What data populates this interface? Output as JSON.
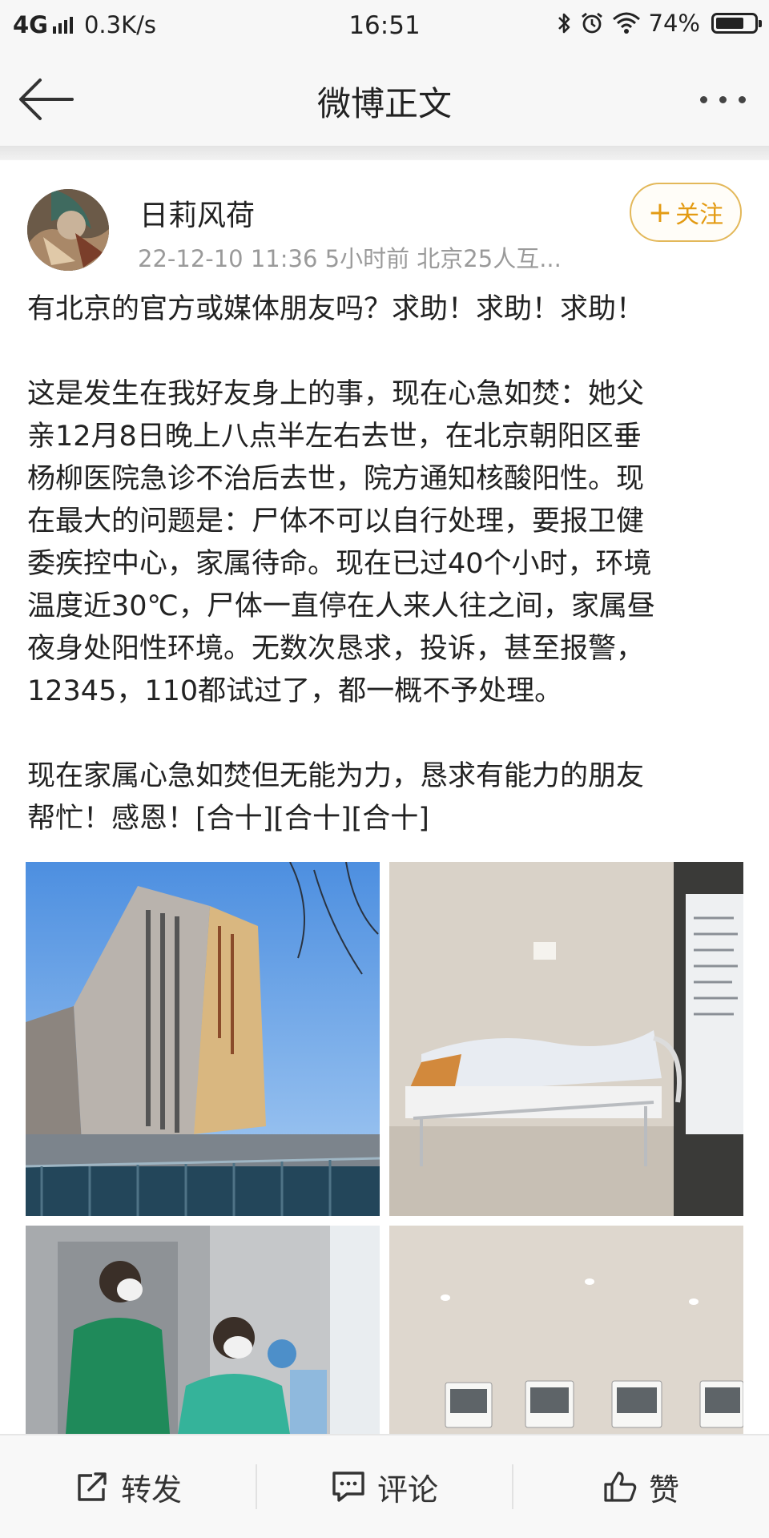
{
  "status_bar": {
    "network": "4G",
    "speed": "0.3K/s",
    "time": "16:51",
    "battery": "74%",
    "battery_level": 0.74
  },
  "nav": {
    "title": "微博正文",
    "back_icon": "arrow-left-icon",
    "more_icon": "more-dots-icon"
  },
  "post": {
    "username": "日莉风荷",
    "meta": "22-12-10 11:36   5小时前 北京25人互...",
    "follow_label": "关注",
    "paragraphs": [
      [
        "有北京的官方或媒体朋友吗？求助！求助！求助！"
      ],
      [
        "这是发生在我好友身上的事，现在心急如焚：她父",
        "亲12月8日晚上八点半左右去世，在北京朝阳区垂",
        "杨柳医院急诊不治后去世，院方通知核酸阳性。现",
        "在最大的问题是：尸体不可以自行处理，要报卫健",
        "委疾控中心，家属待命。现在已过40个小时，环境",
        "温度近30℃，尸体一直停在人来人往之间，家属昼",
        "夜身处阳性环境。无数次恳求，投诉，甚至报警，",
        "12345，110都试过了，都一概不予处理。"
      ],
      [
        "现在家属心急如焚但无能为力，恳求有能力的朋友",
        "帮忙！感恩！[合十][合十][合十]"
      ]
    ],
    "images": [
      {
        "name": "photo-hospital-building"
      },
      {
        "name": "photo-hospital-bed"
      },
      {
        "name": "photo-medical-staff"
      },
      {
        "name": "photo-thermostats"
      }
    ]
  },
  "actions": {
    "repost": "转发",
    "comment": "评论",
    "like": "赞"
  },
  "colors": {
    "follow_accent": "#e39b14",
    "meta_gray": "#9a9a9a"
  }
}
